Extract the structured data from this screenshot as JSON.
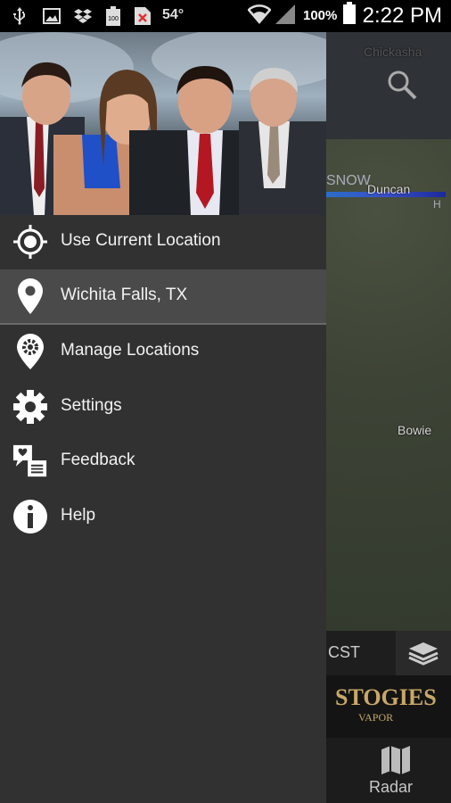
{
  "status_bar": {
    "temperature": "54°",
    "battery_small": "100",
    "battery": "100%",
    "time": "2:22 PM",
    "icons": [
      "usb-icon",
      "gallery-icon",
      "dropbox-icon",
      "battery-100-icon",
      "close-notify-icon",
      "wifi-icon",
      "signal-icon",
      "battery-icon"
    ]
  },
  "drawer": {
    "header_image": "weather-team-photo",
    "items": [
      {
        "label": "Use Current Location",
        "icon": "crosshair-icon",
        "selected": false
      },
      {
        "label": "Wichita Falls, TX",
        "icon": "location-pin-icon",
        "selected": true
      },
      {
        "label": "Manage Locations",
        "icon": "pin-gear-icon",
        "selected": false
      },
      {
        "label": "Settings",
        "icon": "gear-icon",
        "selected": false
      },
      {
        "label": "Feedback",
        "icon": "feedback-icon",
        "selected": false
      },
      {
        "label": "Help",
        "icon": "info-icon",
        "selected": false
      }
    ]
  },
  "map": {
    "labels": {
      "chickasha": "Chickasha",
      "duncan": "Duncan",
      "bowie": "Bowie"
    },
    "legend_label": "SNOW",
    "legend_h": "H",
    "timezone": "CST"
  },
  "ad": {
    "brand": "STOGIES",
    "sub": "VAPOR"
  },
  "bottom_nav": {
    "radar_label": "Radar"
  },
  "colors": {
    "drawer_bg": "#313131",
    "selected_bg": "#4a4a4a",
    "status_bg": "#000000"
  }
}
